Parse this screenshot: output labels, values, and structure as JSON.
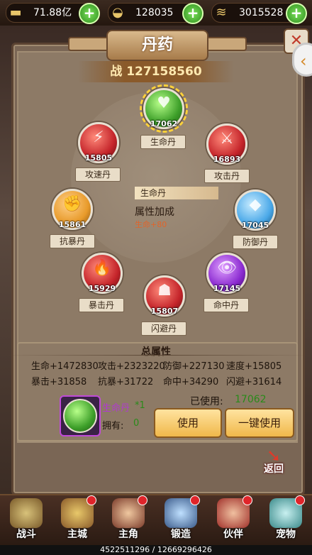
{
  "resources": [
    {
      "icon": "silver-ingot-icon",
      "value": "71.88亿"
    },
    {
      "icon": "gold-ingot-icon",
      "value": "128035"
    },
    {
      "icon": "gold-coins-icon",
      "value": "3015528"
    }
  ],
  "panel": {
    "title": "丹药",
    "power": "战 127158560"
  },
  "pills": [
    {
      "name": "生命丹",
      "count": "17062",
      "color": "green",
      "glyph": "♥"
    },
    {
      "name": "攻速丹",
      "count": "15805",
      "color": "red",
      "glyph": "⚡"
    },
    {
      "name": "攻击丹",
      "count": "16893",
      "color": "red",
      "glyph": "⚔"
    },
    {
      "name": "抗暴丹",
      "count": "15861",
      "color": "orange",
      "glyph": "✊"
    },
    {
      "name": "防御丹",
      "count": "17045",
      "color": "blue",
      "glyph": "◆"
    },
    {
      "name": "暴击丹",
      "count": "15929",
      "color": "red",
      "glyph": "🔥"
    },
    {
      "name": "命中丹",
      "count": "17145",
      "color": "purple",
      "glyph": "👁"
    },
    {
      "name": "闪避丹",
      "count": "15807",
      "color": "red",
      "glyph": "☗"
    }
  ],
  "tooltip": {
    "name": "生命丹",
    "subtitle": "属性加成",
    "value": "生命+80"
  },
  "totals": {
    "title": "总属性",
    "rows": [
      [
        "生命+1472830",
        "攻击+2323220",
        "防御+227130",
        "速度+15805"
      ],
      [
        "暴击+31858",
        "抗暴+31722",
        "命中+34290",
        "闪避+31614"
      ]
    ]
  },
  "selected": {
    "name": "生命丹",
    "qty": "*1",
    "owned_label": "拥有:",
    "owned": "0",
    "used_label": "已使用:",
    "used": "17062"
  },
  "buttons": {
    "use": "使用",
    "use_all": "一键使用",
    "back": "返回"
  },
  "nav": [
    {
      "label": "战斗",
      "badge": false
    },
    {
      "label": "主城",
      "badge": true
    },
    {
      "label": "主角",
      "badge": true
    },
    {
      "label": "锻造",
      "badge": true
    },
    {
      "label": "伙伴",
      "badge": true
    },
    {
      "label": "宠物",
      "badge": true
    }
  ],
  "footer": "4522511296 / 12669296426",
  "colors": {
    "green": "#3ea02a",
    "red": "#c4242a",
    "orange": "#e89a2a",
    "blue": "#4aa8e8",
    "purple": "#8a2ad0"
  }
}
